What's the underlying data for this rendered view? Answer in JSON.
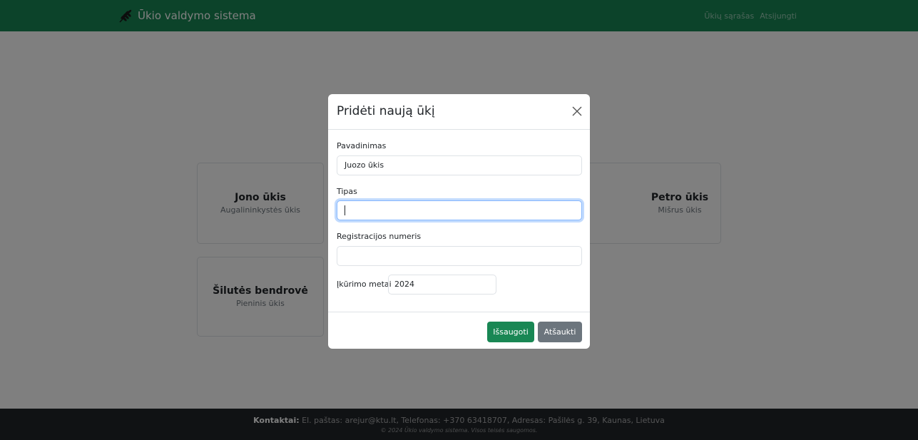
{
  "navbar": {
    "brand": "Ūkio valdymo sistema",
    "links": [
      "Ūkių sąrašas",
      "Atsijungti"
    ]
  },
  "farms": [
    {
      "name": "Jono ūkis",
      "type": "Augalininkystės ūkis"
    },
    {
      "name": "Petro ūkis",
      "type": "Mišrus ūkis"
    },
    {
      "name": "Šilutės bendrovė",
      "type": "Pieninis ūkis"
    }
  ],
  "modal": {
    "title": "Pridėti naują ūkį",
    "name_label": "Pavadinimas",
    "name_value": "Juozo ūkis",
    "type_label": "Tipas",
    "type_value": "",
    "reg_label": "Registracijos numeris",
    "reg_value": "",
    "year_label": "Įkūrimo metai",
    "year_value": "2024",
    "save_label": "Išsaugoti",
    "cancel_label": "Atšaukti"
  },
  "footer": {
    "contacts_label": "Kontaktai:",
    "contacts_text": " El. paštas: arejur@ktu.lt, Telefonas: +370 63418707, Adresas: Pašilės g. 39, Kaunas, Lietuva",
    "copyright": "© 2024 Ūkio valdymo sistema. Visos teisės saugomos."
  },
  "colors": {
    "primary": "#198754",
    "secondary": "#6c757d",
    "footer_bg": "#212529"
  }
}
